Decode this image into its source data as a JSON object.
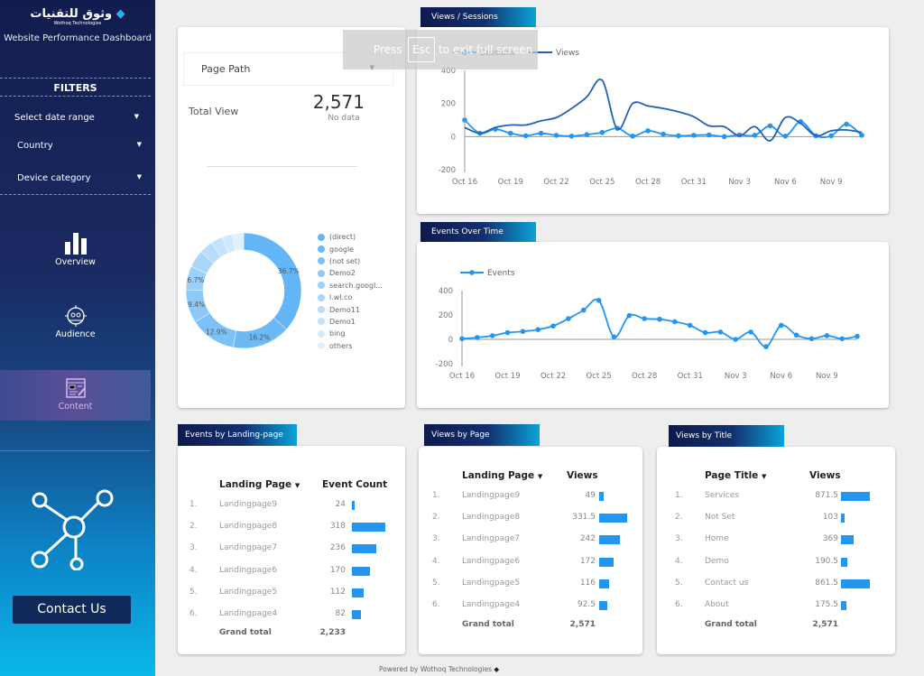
{
  "sidebar": {
    "logo_arabic": "وثوق للتقنيات",
    "logo_english": "Wothoq Technologies",
    "subtitle": "Website Performance Dashboard",
    "filters_title": "FILTERS",
    "filters": [
      {
        "label": "Select date range"
      },
      {
        "label": "Country"
      },
      {
        "label": "Device category"
      }
    ],
    "nav": [
      {
        "label": "Overview",
        "icon": "bar-chart-icon"
      },
      {
        "label": "Audience",
        "icon": "audience-target-icon"
      },
      {
        "label": "Content",
        "icon": "content-edit-icon",
        "active": true
      }
    ],
    "network_icon": "network-hub-icon",
    "contact_label": "Contact Us"
  },
  "summary": {
    "dropdown": "Page Path",
    "total_label": "Total View",
    "total_value": "2,571",
    "total_sub": "No data"
  },
  "donut": {
    "slices": [
      {
        "label": "(direct)",
        "value": 36.7,
        "color": "#64b5f6"
      },
      {
        "label": "google",
        "value": 16.2,
        "color": "#6cb9f6"
      },
      {
        "label": "(not set)",
        "value": 12.9,
        "color": "#7cc1f7"
      },
      {
        "label": "Demo2",
        "value": 9.4,
        "color": "#8cc8f8"
      },
      {
        "label": "search.googl...",
        "value": 6.7,
        "color": "#9dd0f9"
      },
      {
        "label": "l.wl.co",
        "value": 4.8,
        "color": "#aad6fa"
      },
      {
        "label": "Demo11",
        "value": 3.9,
        "color": "#b8dcfa"
      },
      {
        "label": "Demo1",
        "value": 3.3,
        "color": "#c5e3fb"
      },
      {
        "label": "bing",
        "value": 2.9,
        "color": "#d2e9fc"
      },
      {
        "label": "others",
        "value": 3.2,
        "color": "#e0f0fd"
      }
    ],
    "shown_labels": [
      "36.7%",
      "16.2%",
      "12.9%",
      "9.4%",
      "6.7%"
    ]
  },
  "chart_data": [
    {
      "type": "line",
      "title": "Views / Sessions",
      "x": [
        "Oct 16",
        "Oct 17",
        "Oct 18",
        "Oct 19",
        "Oct 20",
        "Oct 21",
        "Oct 22",
        "Oct 23",
        "Oct 24",
        "Oct 25",
        "Oct 26",
        "Oct 27",
        "Oct 28",
        "Oct 29",
        "Oct 30",
        "Oct 31",
        "Nov 1",
        "Nov 2",
        "Nov 3",
        "Nov 4",
        "Nov 5",
        "Nov 6",
        "Nov 7",
        "Nov 8",
        "Nov 9",
        "Nov 10",
        "Nov 11"
      ],
      "xticks": [
        "Oct 16",
        "Oct 19",
        "Oct 22",
        "Oct 25",
        "Oct 28",
        "Oct 31",
        "Nov 3",
        "Nov 6",
        "Nov 9"
      ],
      "yticks": [
        400,
        200,
        0,
        -200
      ],
      "ylim": [
        -200,
        400
      ],
      "series": [
        {
          "name": "Sessions",
          "color": "#2196f3",
          "markers": true,
          "values": [
            100,
            20,
            45,
            20,
            5,
            20,
            8,
            3,
            12,
            25,
            50,
            3,
            35,
            15,
            5,
            8,
            10,
            0,
            10,
            8,
            65,
            3,
            90,
            5,
            5,
            75,
            8
          ]
        },
        {
          "name": "Views",
          "color": "#1e63b8",
          "markers": false,
          "values": [
            55,
            20,
            55,
            70,
            70,
            95,
            115,
            170,
            240,
            340,
            45,
            200,
            185,
            170,
            150,
            120,
            65,
            60,
            5,
            60,
            -25,
            115,
            80,
            5,
            35,
            40,
            25
          ]
        }
      ]
    },
    {
      "type": "line",
      "title": "Events Over Time",
      "x": [
        "Oct 16",
        "Oct 17",
        "Oct 18",
        "Oct 19",
        "Oct 20",
        "Oct 21",
        "Oct 22",
        "Oct 23",
        "Oct 24",
        "Oct 25",
        "Oct 26",
        "Oct 27",
        "Oct 28",
        "Oct 29",
        "Oct 30",
        "Oct 31",
        "Nov 1",
        "Nov 2",
        "Nov 3",
        "Nov 4",
        "Nov 5",
        "Nov 6",
        "Nov 7",
        "Nov 8",
        "Nov 9",
        "Nov 10",
        "Nov 11"
      ],
      "xticks": [
        "Oct 16",
        "Oct 19",
        "Oct 22",
        "Oct 25",
        "Oct 28",
        "Oct 31",
        "Nov 3",
        "Nov 6",
        "Nov 9"
      ],
      "yticks": [
        400,
        200,
        0,
        -200
      ],
      "ylim": [
        -200,
        400
      ],
      "series": [
        {
          "name": "Events",
          "color": "#2196f3",
          "markers": true,
          "values": [
            5,
            15,
            30,
            55,
            65,
            80,
            110,
            170,
            240,
            320,
            20,
            195,
            170,
            165,
            145,
            115,
            55,
            60,
            0,
            60,
            -60,
            115,
            35,
            5,
            30,
            5,
            25
          ]
        }
      ]
    }
  ],
  "tables": [
    {
      "title": "Events by Landing-page",
      "col1": "Landing Page",
      "col2": "Event Count",
      "rows": [
        [
          "Landingpage9",
          24,
          "24"
        ],
        [
          "Landingpage8",
          318,
          "318"
        ],
        [
          "Landingpage7",
          236,
          "236"
        ],
        [
          "Landingpage6",
          170,
          "170"
        ],
        [
          "Landingpage5",
          112,
          "112"
        ],
        [
          "Landingpage4",
          82,
          "82"
        ]
      ],
      "total_label": "Grand total",
      "total": "2,233"
    },
    {
      "title": "Views by Page",
      "col1": "Landing Page",
      "col2": "Views",
      "rows": [
        [
          "Landingpage9",
          49,
          "49"
        ],
        [
          "Landingpage8",
          331.5,
          "331.5"
        ],
        [
          "Landingpage7",
          242,
          "242"
        ],
        [
          "Landingpage6",
          172,
          "172"
        ],
        [
          "Landingpage5",
          116,
          "116"
        ],
        [
          "Landingpage4",
          92.5,
          "92.5"
        ]
      ],
      "total_label": "Grand total",
      "total": "2,571"
    },
    {
      "title": "Views by Title",
      "col1": "Page Title",
      "col2": "Views",
      "rows": [
        [
          "Services",
          871.5,
          "871.5"
        ],
        [
          "Not Set",
          103,
          "103"
        ],
        [
          "Home",
          369,
          "369"
        ],
        [
          "Demo",
          190.5,
          "190.5"
        ],
        [
          "Contact us",
          861.5,
          "861.5"
        ],
        [
          "About",
          175.5,
          "175.5"
        ]
      ],
      "total_label": "Grand total",
      "total": "2,571"
    }
  ],
  "footer": "Powered by Wothoq Technologies",
  "overlay": {
    "press": "Press",
    "key": "Esc",
    "rest": "to exit full screen"
  }
}
